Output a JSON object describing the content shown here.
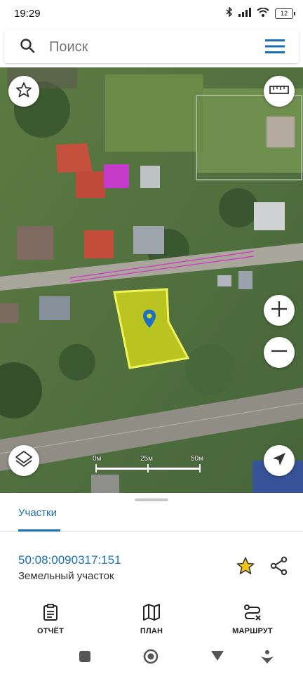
{
  "status": {
    "time": "19:29",
    "battery": "12"
  },
  "search": {
    "placeholder": "Поиск"
  },
  "map": {
    "scale_labels": [
      "0м",
      "25м",
      "50м"
    ],
    "colors": {
      "parcel_fill": "#d8dc1a",
      "parcel_stroke": "#f2f25a",
      "marker": "#1f6fc2",
      "highlight_roof": "#c53bc9"
    }
  },
  "sheet": {
    "tab_label": "Участки",
    "cadastral_number": "50:08:0090317:151",
    "parcel_type": "Земельный участок"
  },
  "bottom_nav": {
    "report": "ОТЧЁТ",
    "plan": "ПЛАН",
    "route": "МАРШРУТ"
  }
}
